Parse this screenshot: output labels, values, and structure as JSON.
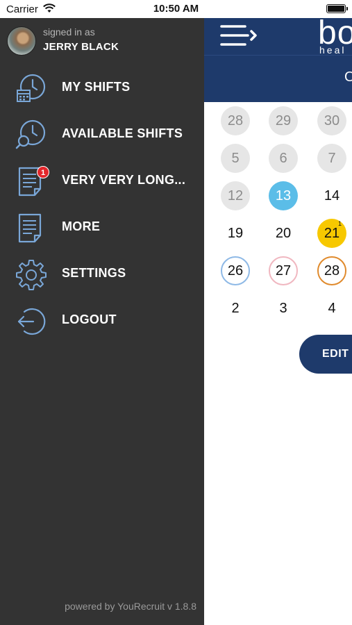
{
  "status_bar": {
    "carrier": "Carrier",
    "time": "10:50 AM",
    "battery_level": 1.0
  },
  "drawer": {
    "signed_in_label": "signed in as",
    "user_name": "JERRY BLACK",
    "menu": [
      {
        "label": "MY SHIFTS",
        "icon": "calendar-clock-icon"
      },
      {
        "label": "AVAILABLE SHIFTS",
        "icon": "clock-search-icon"
      },
      {
        "label": "VERY VERY LONG...",
        "icon": "document-icon",
        "badge": "1"
      },
      {
        "label": "MORE",
        "icon": "document-icon"
      },
      {
        "label": "SETTINGS",
        "icon": "gear-icon"
      },
      {
        "label": "LOGOUT",
        "icon": "logout-icon"
      }
    ],
    "powered_by": "powered by YouRecruit v 1.8.8"
  },
  "main": {
    "brand_text": "bo",
    "brand_sub": "heal",
    "month_partial": "O",
    "calendar_rows": [
      [
        "28",
        "29",
        "30"
      ],
      [
        "5",
        "6",
        "7"
      ],
      [
        "12",
        "13",
        "14"
      ],
      [
        "19",
        "20",
        "21"
      ],
      [
        "26",
        "27",
        "28"
      ],
      [
        "2",
        "3",
        "4"
      ]
    ],
    "shift_count_21": "1",
    "edit_button": "EDIT"
  },
  "colors": {
    "drawer_bg": "#333333",
    "nav_blue": "#1e3a6b",
    "icon_blue": "#7aa7d8",
    "today": "#5bbde8",
    "shift_yellow": "#f7c800",
    "badge_red": "#e3262b"
  }
}
